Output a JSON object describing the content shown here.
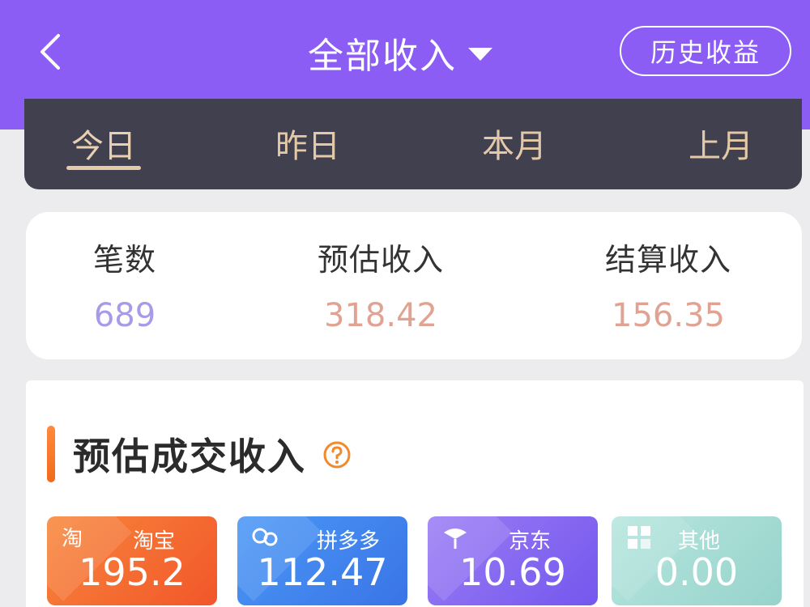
{
  "header": {
    "title": "全部收入",
    "history_button": "历史收益"
  },
  "tabs": [
    {
      "label": "今日",
      "active": true
    },
    {
      "label": "昨日",
      "active": false
    },
    {
      "label": "本月",
      "active": false
    },
    {
      "label": "上月",
      "active": false
    }
  ],
  "stats": [
    {
      "label": "笔数",
      "value": "689",
      "color": "#a89ae8"
    },
    {
      "label": "预估收入",
      "value": "318.42",
      "color": "#e0a393"
    },
    {
      "label": "结算收入",
      "value": "156.35",
      "color": "#e0a393"
    }
  ],
  "section": {
    "title": "预估成交收入"
  },
  "platforms": [
    {
      "name": "淘宝",
      "value": "195.2",
      "icon": "taobao-icon",
      "color": "#f4652d"
    },
    {
      "name": "拼多多",
      "value": "112.47",
      "icon": "pinduoduo-icon",
      "color": "#3f86f0"
    },
    {
      "name": "京东",
      "value": "10.69",
      "icon": "jd-icon",
      "color": "#8a6df2"
    },
    {
      "name": "其他",
      "value": "0.00",
      "icon": "other-grid-icon",
      "color": "#a6ddd6"
    }
  ],
  "colors": {
    "header_bg": "#8b5df5",
    "tab_bar_bg": "#40404f",
    "tab_text": "#e4c9a9",
    "accent_orange": "#f26a1b"
  }
}
